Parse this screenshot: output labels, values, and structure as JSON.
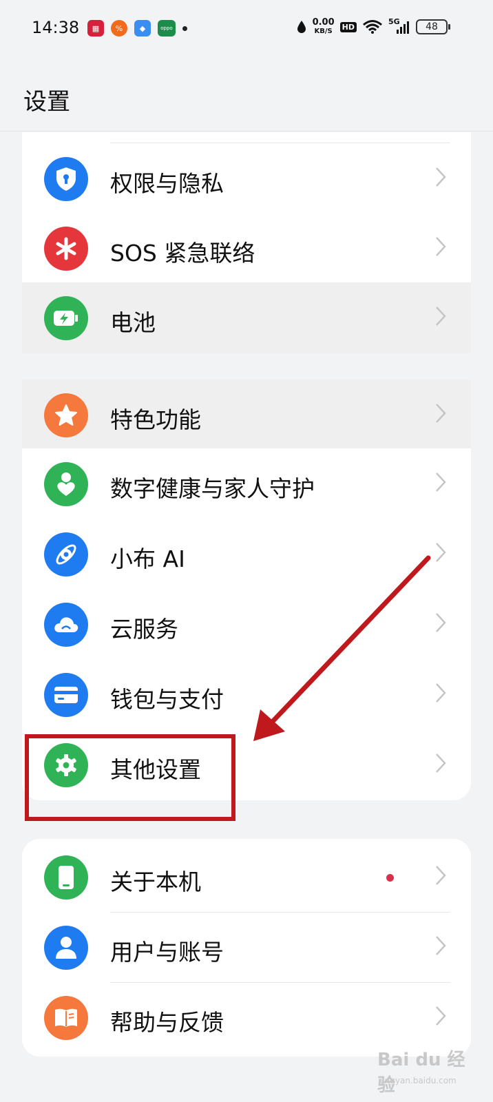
{
  "status_bar": {
    "time": "14:38",
    "net_speed_value": "0.00",
    "net_speed_unit": "KB/S",
    "hd_label": "HD",
    "signal_label": "5G",
    "battery_level": "48"
  },
  "header": {
    "title": "设置"
  },
  "group1": {
    "items": [
      {
        "label": "权限与隐私",
        "icon": "shield-keyhole-icon",
        "color": "#1e7cf0"
      },
      {
        "label": "SOS 紧急联络",
        "icon": "asterisk-icon",
        "color": "#e5363b"
      },
      {
        "label": "电池",
        "icon": "battery-icon",
        "color": "#2fb356"
      },
      {
        "label": "特色功能",
        "icon": "star-icon",
        "color": "#f5793c"
      },
      {
        "label": "数字健康与家人守护",
        "icon": "person-heart-icon",
        "color": "#2fb356"
      },
      {
        "label": "小布 AI",
        "icon": "ai-orbit-icon",
        "color": "#1e7cf0"
      },
      {
        "label": "云服务",
        "icon": "cloud-icon",
        "color": "#1e7cf0"
      },
      {
        "label": "钱包与支付",
        "icon": "card-icon",
        "color": "#1e7cf0"
      },
      {
        "label": "其他设置",
        "icon": "gear-icon",
        "color": "#2fb356"
      }
    ]
  },
  "group2": {
    "items": [
      {
        "label": "关于本机",
        "icon": "phone-icon",
        "color": "#2fb356",
        "has_badge": true
      },
      {
        "label": "用户与账号",
        "icon": "user-icon",
        "color": "#1e7cf0"
      },
      {
        "label": "帮助与反馈",
        "icon": "book-icon",
        "color": "#f5793c"
      }
    ]
  },
  "annotation": {
    "highlight_target": "其他设置",
    "color": "#c0191d"
  },
  "watermark": {
    "brand": "Bai du 经验",
    "url": "jingyan.baidu.com"
  }
}
